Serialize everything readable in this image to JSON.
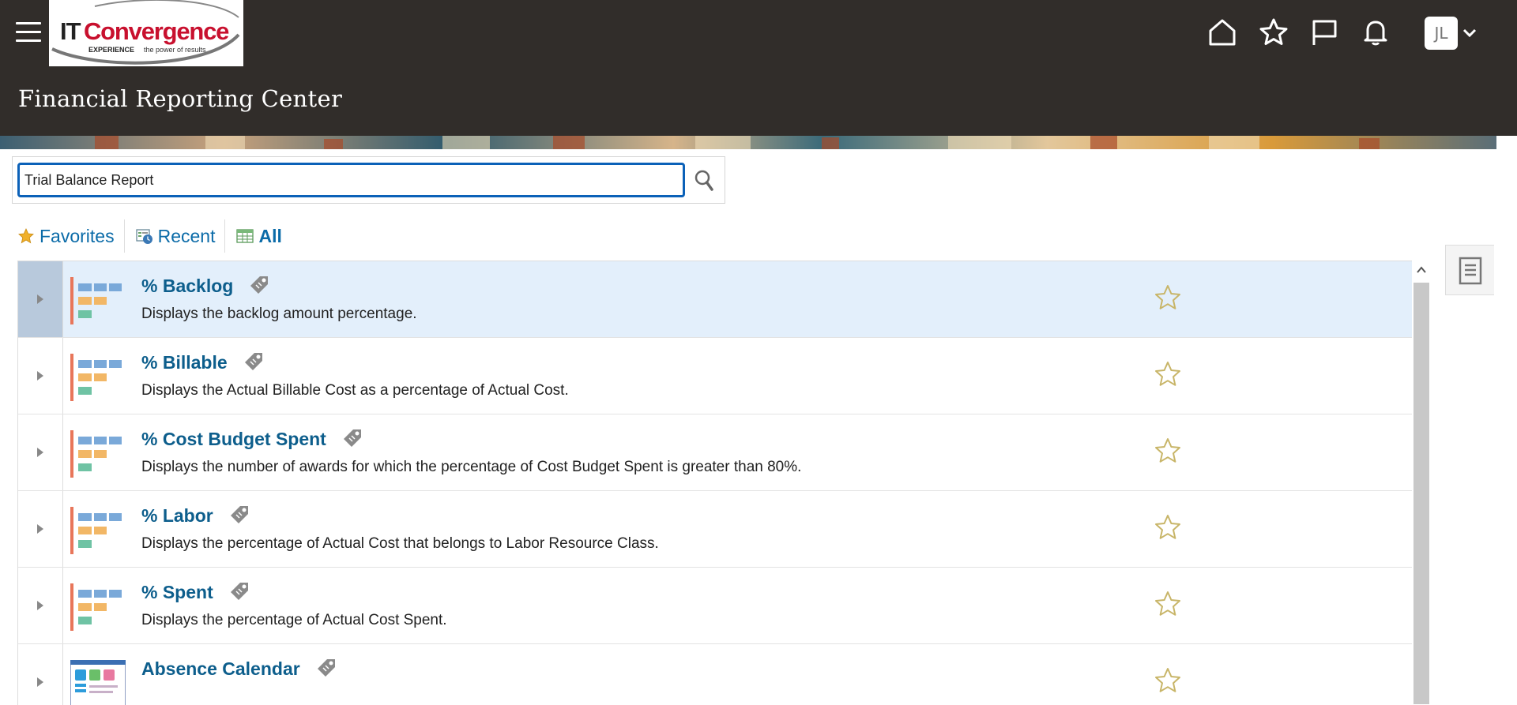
{
  "header": {
    "page_title": "Financial Reporting Center",
    "logo": {
      "brand_it": "IT",
      "brand_rest": "Convergence",
      "tagline_bold": "EXPERIENCE",
      "tagline_rest": "the power of results"
    },
    "icons": [
      "home-icon",
      "favorites-star-icon",
      "flag-icon",
      "bell-icon"
    ],
    "user_initials": "JL"
  },
  "search": {
    "value": "Trial Balance Report",
    "placeholder": ""
  },
  "tabs": [
    {
      "label": "Favorites",
      "icon": "star-icon",
      "selected": false
    },
    {
      "label": "Recent",
      "icon": "recent-icon",
      "selected": false
    },
    {
      "label": "All",
      "icon": "grid-icon",
      "selected": true
    }
  ],
  "items": [
    {
      "name": "% Backlog",
      "description": "Displays the backlog amount percentage.",
      "icon": "kpi-icon",
      "selected": true
    },
    {
      "name": "% Billable",
      "description": "Displays the Actual Billable Cost as a percentage of Actual Cost.",
      "icon": "kpi-icon",
      "selected": false
    },
    {
      "name": "% Cost Budget Spent",
      "description": "Displays the number of awards for which the percentage of Cost Budget Spent is greater than 80%.",
      "icon": "kpi-icon",
      "selected": false
    },
    {
      "name": "% Labor",
      "description": "Displays the percentage of Actual Cost that belongs to Labor Resource Class.",
      "icon": "kpi-icon",
      "selected": false
    },
    {
      "name": "% Spent",
      "description": "Displays the percentage of Actual Cost Spent.",
      "icon": "kpi-icon",
      "selected": false
    },
    {
      "name": "Absence Calendar",
      "description": "",
      "icon": "dashboard-icon",
      "selected": false
    }
  ],
  "colors": {
    "header_bg": "#312d2a",
    "link": "#0d5e8c",
    "selected_row": "#e3effb",
    "focus_border": "#0b61b8",
    "star_outline": "#c8b568"
  }
}
